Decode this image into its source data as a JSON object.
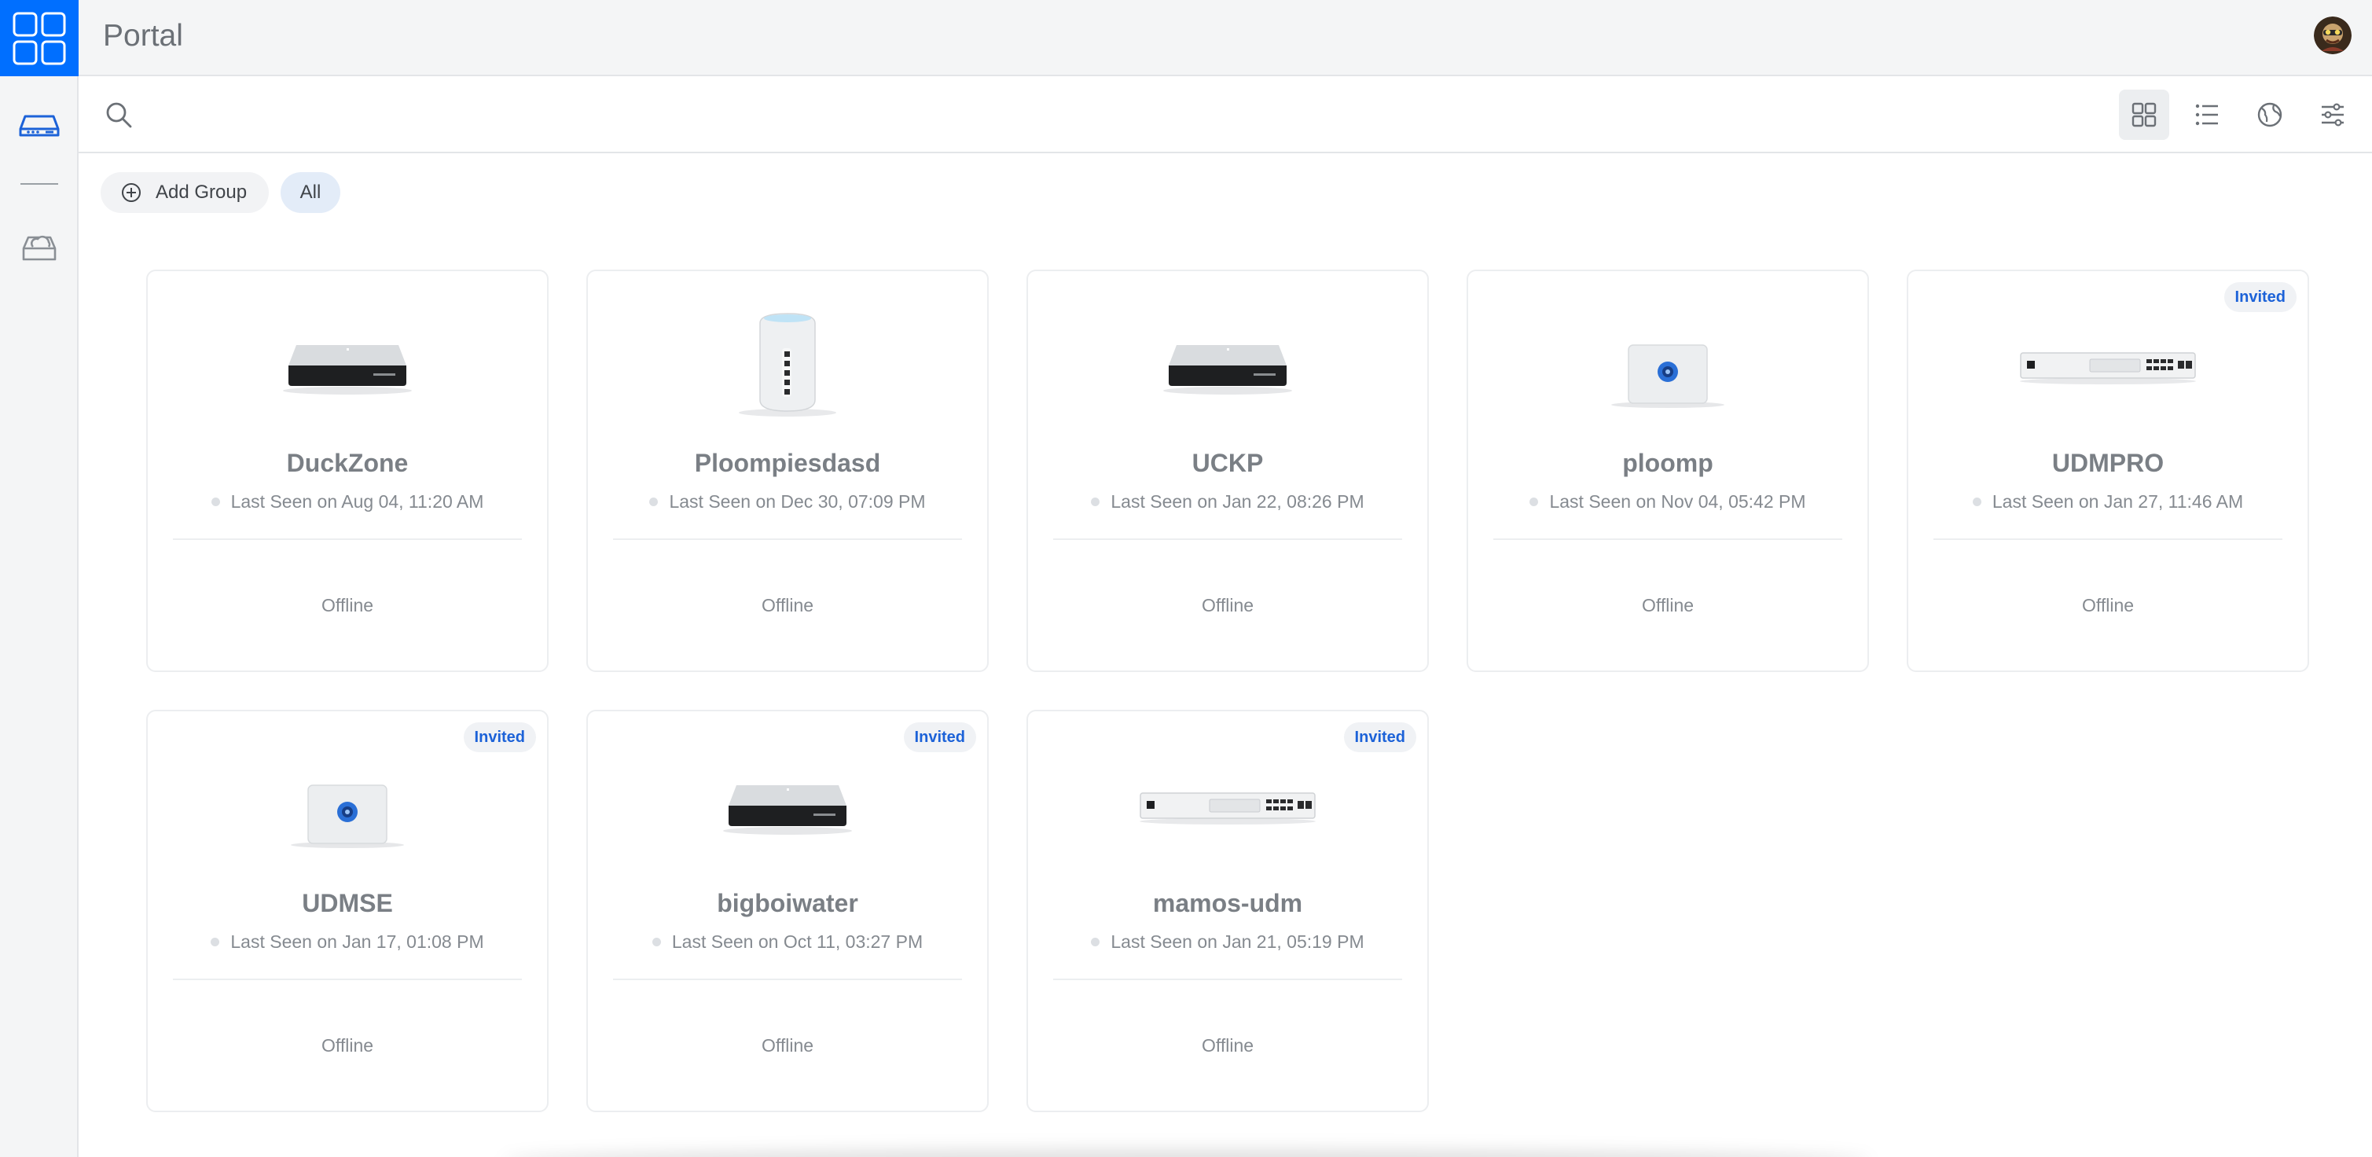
{
  "app": {
    "title": "Portal",
    "accent_color": "#006fff"
  },
  "rail": {
    "items": [
      {
        "name": "ui-grid-logo-icon",
        "active": true
      },
      {
        "name": "console-icon",
        "active": true
      },
      {
        "name": "cloud-gateway-icon",
        "active": false
      }
    ]
  },
  "toolbar": {
    "search_placeholder": "",
    "view_buttons": [
      "grid-view-icon",
      "list-view-icon",
      "globe-icon",
      "filters-icon"
    ],
    "active_view": "grid"
  },
  "groups": {
    "add_label": "Add Group",
    "all_label": "All"
  },
  "devices": [
    {
      "name": "DuckZone",
      "last_seen": "Last Seen on Aug 04, 11:20 AM",
      "status": "Offline",
      "badge": "",
      "model": "black-box"
    },
    {
      "name": "Ploompiesdasd",
      "last_seen": "Last Seen on Dec 30, 07:09 PM",
      "status": "Offline",
      "badge": "",
      "model": "tower"
    },
    {
      "name": "UCKP",
      "last_seen": "Last Seen on Jan 22, 08:26 PM",
      "status": "Offline",
      "badge": "",
      "model": "black-box"
    },
    {
      "name": "ploomp",
      "last_seen": "Last Seen on Nov 04, 05:42 PM",
      "status": "Offline",
      "badge": "",
      "model": "cube"
    },
    {
      "name": "UDMPRO",
      "last_seen": "Last Seen on Jan 27, 11:46 AM",
      "status": "Offline",
      "badge": "Invited",
      "model": "rack"
    },
    {
      "name": "UDMSE",
      "last_seen": "Last Seen on Jan 17, 01:08 PM",
      "status": "Offline",
      "badge": "Invited",
      "model": "cube"
    },
    {
      "name": "bigboiwater",
      "last_seen": "Last Seen on Oct 11, 03:27 PM",
      "status": "Offline",
      "badge": "Invited",
      "model": "black-box"
    },
    {
      "name": "mamos-udm",
      "last_seen": "Last Seen on Jan 21, 05:19 PM",
      "status": "Offline",
      "badge": "Invited",
      "model": "rack"
    }
  ]
}
